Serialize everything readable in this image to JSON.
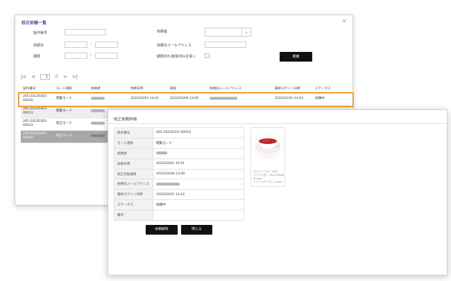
{
  "list_window": {
    "title": "校正依頼一覧",
    "close_glyph": "×",
    "form": {
      "operation_no_label": "操作番号",
      "operation_no_value": "",
      "request_date_label": "依頼日",
      "request_date_from": "",
      "request_date_to": "",
      "deadline_label": "期限",
      "deadline_from": "",
      "deadline_to": "",
      "range_dash": "-",
      "requester_label": "依頼者",
      "requester_value": "",
      "requester_email_label": "依頼先メールアドレス",
      "requester_email_value": "",
      "exclude_label": "期限切れ/削除済みを除く",
      "search_button": "検索"
    },
    "pager": {
      "first": "|<",
      "prev": "<",
      "page_value": "1",
      "total": "/1",
      "next": ">",
      "last": ">|"
    },
    "columns": [
      "操作番号",
      "モード選択",
      "依頼者",
      "依頼日時",
      "期限",
      "依頼先メールアドレス",
      "最終ログイン日時",
      "ステータス"
    ],
    "rows": [
      {
        "op_no": "265-20220301-00016",
        "mode": "閲覧モード",
        "requested_at": "2022/03/01 14:01",
        "deadline": "2022/03/09 23:00",
        "last_login": "2022/03/01 14:02",
        "status": "依頼中"
      },
      {
        "op_no": "265-20220301-00013",
        "mode": "閲覧モード",
        "requested_at": "",
        "deadline": "",
        "last_login": "",
        "status": ""
      },
      {
        "op_no": "265-20220301-00012",
        "mode": "校正モード",
        "requested_at": "",
        "deadline": "",
        "last_login": "",
        "status": ""
      },
      {
        "op_no": "265-20220301-00000",
        "mode": "校正モード",
        "requested_at": "",
        "deadline": "",
        "last_login": "",
        "status": ""
      }
    ]
  },
  "detail_window": {
    "title": "校正依頼詳細",
    "fields": [
      {
        "label": "操作番号",
        "value": "265-20220301-00016"
      },
      {
        "label": "モード選択",
        "value": "閲覧モード"
      },
      {
        "label": "依頼者",
        "value": ""
      },
      {
        "label": "依頼日時",
        "value": "2022/03/01 14:01"
      },
      {
        "label": "校正可能期限",
        "value": "2022/03/09 23:00"
      },
      {
        "label": "依頼先メールアドレス",
        "value": ""
      },
      {
        "label": "最終ログイン日時",
        "value": "2022/03/01 14:02"
      },
      {
        "label": "ステータス",
        "value": "依頼中"
      },
      {
        "label": "備考",
        "value": ""
      }
    ],
    "thumbnail": {
      "caption_line1": "コンテンツID：206",
      "caption_line2": "ファイル名：1613766886",
      "caption_line3": "00.jpg",
      "caption_line4": "ファイルサイズ：5.4kb"
    },
    "cancel_request_button": "依頼解除",
    "close_button": "閉じる"
  },
  "colors": {
    "title_accent": "#5a4a9a",
    "row_highlight": "#f39c3a",
    "button_bg": "#111111"
  }
}
